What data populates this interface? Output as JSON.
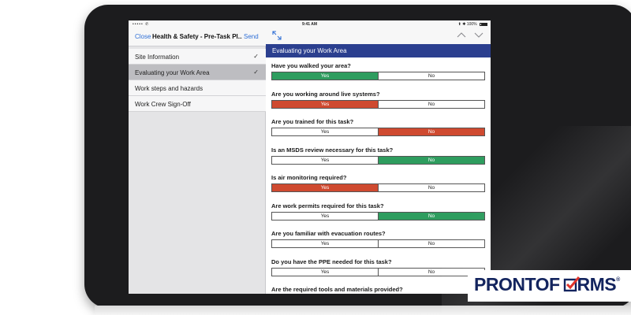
{
  "status_bar": {
    "left": "•••••  ✆",
    "time": "9:41 AM",
    "right": "⬆ ✱ 100%"
  },
  "left_pane": {
    "close_label": "Close",
    "title": "Health & Safety - Pre-Task Pl...",
    "send_label": "Send",
    "sections": [
      {
        "label": "Site Information",
        "checked": true,
        "active": false
      },
      {
        "label": "Evaluating your Work Area",
        "checked": true,
        "active": true
      },
      {
        "label": "Work steps and hazards",
        "checked": false,
        "active": false
      },
      {
        "label": "Work Crew Sign-Off",
        "checked": false,
        "active": false
      }
    ],
    "check_glyph": "✓"
  },
  "right_pane": {
    "icons": {
      "expand": "expand-icon",
      "up": "chevron-up-icon",
      "down": "chevron-down-icon"
    },
    "section_title": "Evaluating your Work Area",
    "yes_label": "Yes",
    "no_label": "No",
    "questions": [
      {
        "label": "Have you walked your area?",
        "selected": "yes"
      },
      {
        "label": "Are you working around live systems?",
        "selected": "yes"
      },
      {
        "label": "Are you trained for this task?",
        "selected": "no"
      },
      {
        "label": "Is an MSDS review necessary for this task?",
        "selected": "no"
      },
      {
        "label": "Is air monitoring required?",
        "selected": "yes"
      },
      {
        "label": "Are work permits required for this task?",
        "selected": "no"
      },
      {
        "label": "Are you familiar with evacuation routes?",
        "selected": "none"
      },
      {
        "label": "Do you have the PPE needed for this task?",
        "selected": "none"
      },
      {
        "label": "Are the required tools and materials provided?",
        "selected": "none"
      }
    ],
    "colors": {
      "header": "#2b3f8f",
      "green": "#2e9d5f",
      "red": "#cf4a30"
    }
  },
  "logo": {
    "text_before": "PRONTOF",
    "text_after": "RMS",
    "registered": "®",
    "icon": "checkbox-check-icon"
  }
}
